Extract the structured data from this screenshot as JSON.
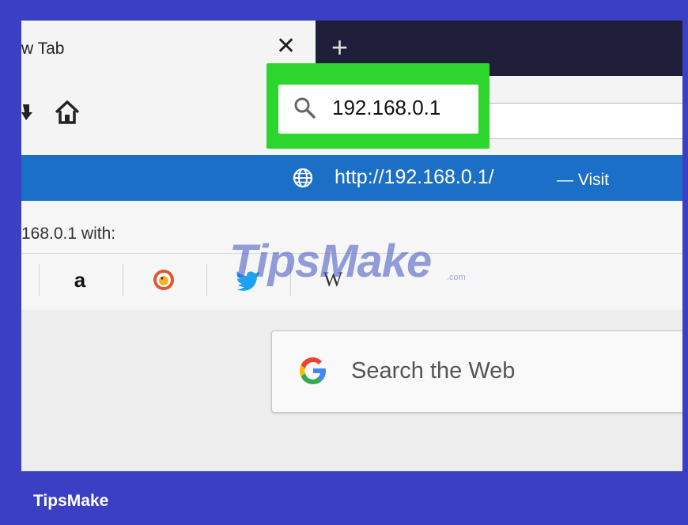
{
  "browser": {
    "tab": {
      "title": "w Tab",
      "close_glyph": "✕"
    },
    "new_tab_glyph": "+",
    "toolbar": {
      "overflow_icon": "download-icon",
      "home_icon": "home-icon"
    },
    "address_bar": {
      "value": "192.168.0.1",
      "icon": "search-icon",
      "highlight_color": "#2dd62d"
    },
    "suggestion": {
      "icon": "globe-icon",
      "url": "http://192.168.0.1/",
      "action": "— Visit",
      "bg_color": "#1c6fc6"
    },
    "search_with": {
      "label": "168.0.1 with:",
      "engines": [
        {
          "name": "amazon",
          "glyph": "a"
        },
        {
          "name": "duckduckgo",
          "glyph": ""
        },
        {
          "name": "twitter",
          "glyph": ""
        },
        {
          "name": "wikipedia",
          "glyph": "W"
        }
      ]
    },
    "web_search": {
      "placeholder": "Search the Web",
      "icon": "google-icon"
    }
  },
  "watermark": {
    "text": "TipsMake",
    "domain": ".com"
  },
  "footer": {
    "brand": "TipsMake"
  }
}
